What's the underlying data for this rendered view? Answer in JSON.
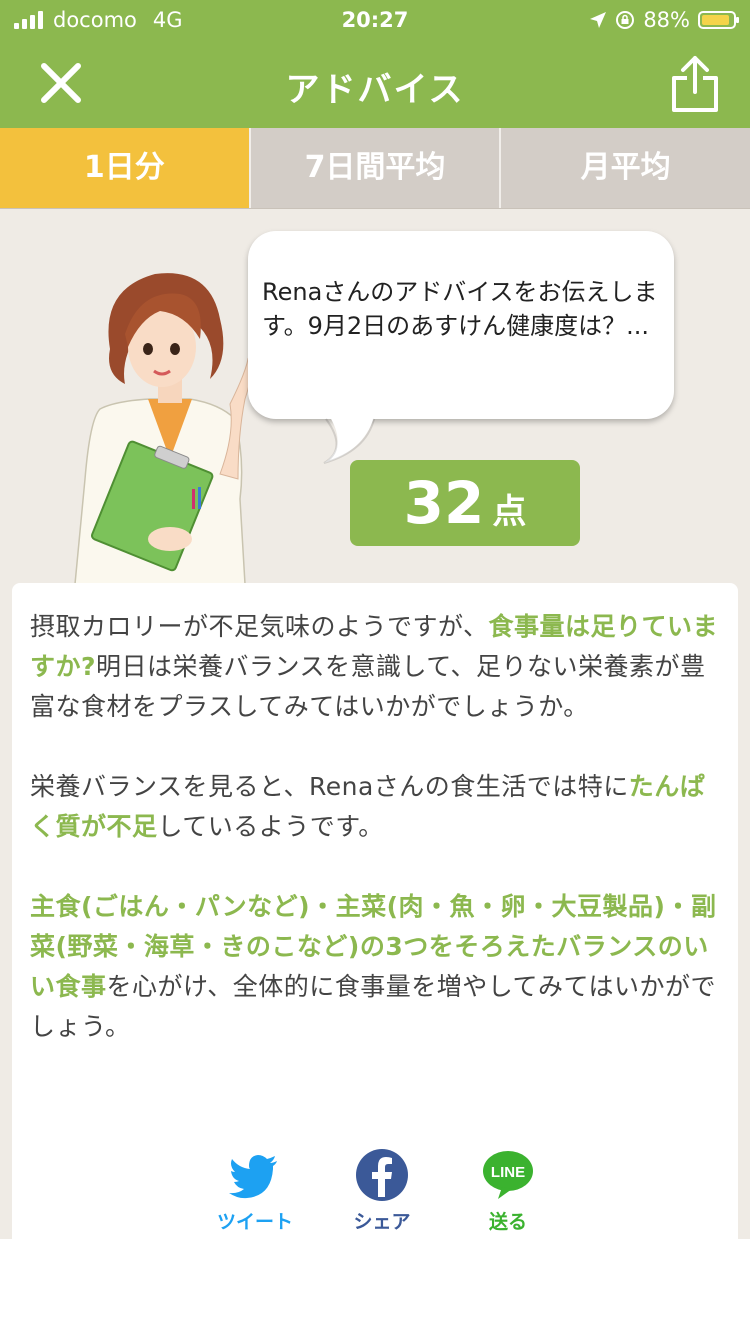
{
  "status_bar": {
    "carrier": "docomo",
    "network": "4G",
    "time": "20:27",
    "battery": "88%"
  },
  "header": {
    "title": "アドバイス",
    "close_icon": "close-icon",
    "share_icon": "share-icon"
  },
  "tabs": [
    {
      "label": "1日分",
      "active": true
    },
    {
      "label": "7日間平均",
      "active": false
    },
    {
      "label": "月平均",
      "active": false
    }
  ],
  "advice": {
    "speech": "Renaさんのアドバイスをお伝えします。9月2日のあすけん健康度は？...",
    "score": "32",
    "score_unit": "点"
  },
  "body": {
    "p1_a": "摂取カロリーが不足気味のようですが、",
    "p1_b": "食事量は足りていますか?",
    "p1_c": "明日は栄養バランスを意識して、足りない栄養素が豊富な食材をプラスしてみてはいかがでしょうか。",
    "p2_a": "栄養バランスを見ると、Renaさんの食生活では特に",
    "p2_b": "たんぱく質が不足",
    "p2_c": "しているようです。",
    "p3_a": "主食(ごはん・パンなど)・主菜(肉・魚・卵・大豆製品)・副菜(野菜・海草・きのこなど)の3つをそろえたバランスのいい食事",
    "p3_b": "を心がけ、全体的に食事量を増やしてみてはいかがでしょう。"
  },
  "share": [
    {
      "label": "ツイート",
      "icon": "twitter-icon",
      "color": "#1da1f2"
    },
    {
      "label": "シェア",
      "icon": "facebook-icon",
      "color": "#3b5998"
    },
    {
      "label": "送る",
      "icon": "line-icon",
      "color": "#3bb22f",
      "icon_text": "LINE"
    }
  ],
  "colors": {
    "brand_green": "#8cb84f",
    "active_tab": "#f3c13d",
    "inactive_tab": "#d3cdc7"
  }
}
